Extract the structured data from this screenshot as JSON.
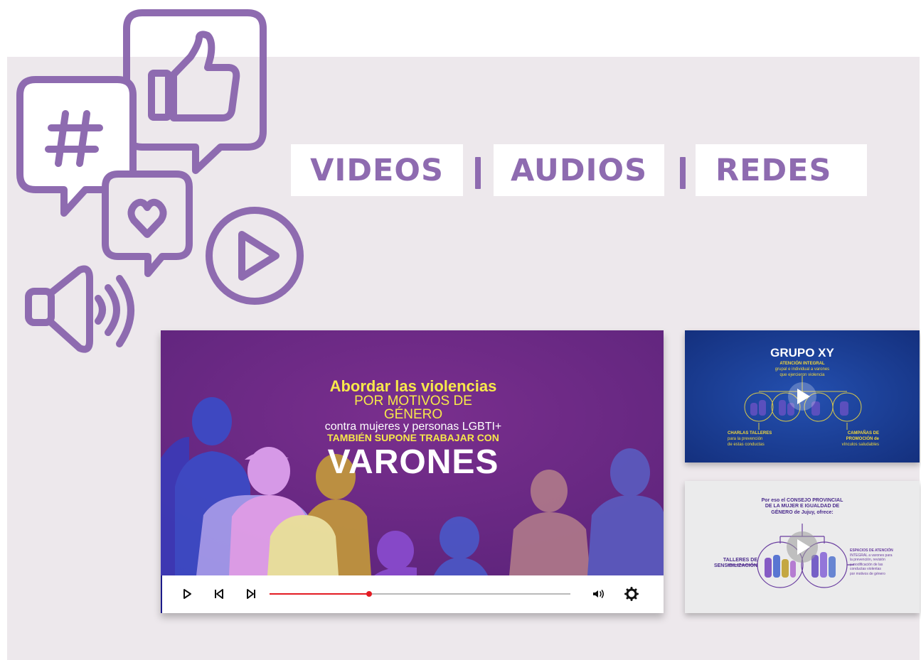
{
  "colors": {
    "accent": "#8e6bb0",
    "panel_bg": "#ede8ec",
    "video_bg": "#6a2a8a",
    "progress": "#e31b23",
    "thumb1_bg": "#1a3c94",
    "thumb2_bg": "#e9e9ea"
  },
  "icons": [
    "hashtag-bubble-icon",
    "thumbs-up-bubble-icon",
    "heart-bubble-icon",
    "play-circle-icon",
    "speaker-icon"
  ],
  "tabs": [
    {
      "label": "VIDEOS"
    },
    {
      "label": "AUDIOS"
    },
    {
      "label": "REDES"
    }
  ],
  "main_video": {
    "line1": "Abordar las violencias",
    "line2": "POR MOTIVOS DE GÉNERO",
    "line3": "contra mujeres y personas LGBTI+",
    "line4": "TAMBIÉN SUPONE TRABAJAR CON",
    "line5": "VARONES",
    "progress": 0.33,
    "controls": [
      "play-icon",
      "skip-back-icon",
      "skip-forward-icon",
      "volume-icon",
      "settings-icon"
    ]
  },
  "thumbnails": [
    {
      "title": "GRUPO XY",
      "sub1": "ATENCIÓN INTEGRAL",
      "sub2": "grupal e individual a varones",
      "sub3": "que ejercieron violencia",
      "left": "CHARLAS TALLERES",
      "left2": "para la prevención",
      "left3": "de estas conductas",
      "right": "CAMPAÑAS DE",
      "right2": "PROMOCIÓN de",
      "right3": "vínculos saludables"
    },
    {
      "title1": "Por eso el CONSEJO PROVINCIAL",
      "title2": "DE LA MUJER E IGUALDAD DE",
      "title3": "GÉNERO de Jujuy, ofrece:",
      "left1": "TALLERES DE",
      "left2": "SENSIBILIZACIÓN",
      "right1": "ESPACIOS DE ATENCIÓN",
      "right2": "INTEGRAL a varones para",
      "right3": "la prevención, revisión",
      "right4": "y modificación de las",
      "right5": "conductas violentas",
      "right6": "por motivos de género"
    }
  ]
}
